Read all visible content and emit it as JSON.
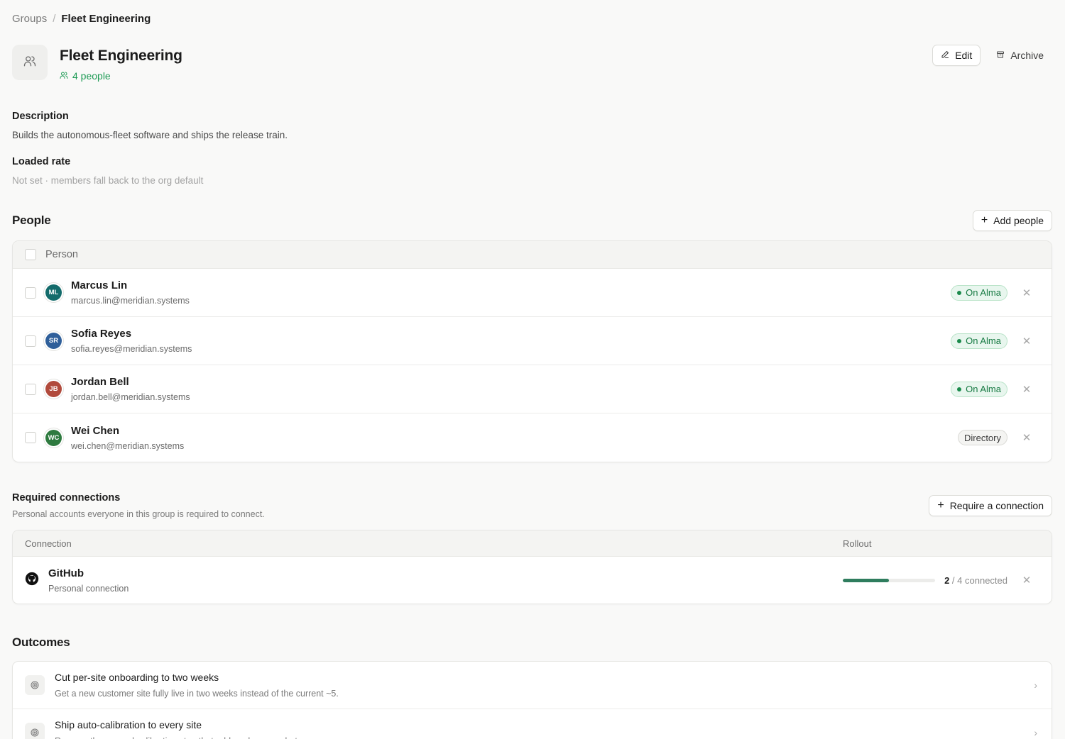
{
  "breadcrumb": {
    "parent": "Groups",
    "separator": "/",
    "current": "Fleet Engineering"
  },
  "group": {
    "title": "Fleet Engineering",
    "people_count": "4 people"
  },
  "header_actions": {
    "edit_label": "Edit",
    "archive_label": "Archive"
  },
  "description": {
    "label": "Description",
    "value": "Builds the autonomous-fleet software and ships the release train."
  },
  "loaded_rate": {
    "label": "Loaded rate",
    "value": "Not set · members fall back to the org default"
  },
  "people": {
    "title": "People",
    "add_label": "Add people",
    "column_person": "Person",
    "rows": [
      {
        "initials": "ML",
        "name": "Marcus Lin",
        "email": "marcus.lin@meridian.systems",
        "status": "On Alma",
        "status_type": "alma",
        "avatar_color": "#136b6b"
      },
      {
        "initials": "SR",
        "name": "Sofia Reyes",
        "email": "sofia.reyes@meridian.systems",
        "status": "On Alma",
        "status_type": "alma",
        "avatar_color": "#2f5f9a"
      },
      {
        "initials": "JB",
        "name": "Jordan Bell",
        "email": "jordan.bell@meridian.systems",
        "status": "On Alma",
        "status_type": "alma",
        "avatar_color": "#b14a3c"
      },
      {
        "initials": "WC",
        "name": "Wei Chen",
        "email": "wei.chen@meridian.systems",
        "status": "Directory",
        "status_type": "directory",
        "avatar_color": "#2e7a3f"
      }
    ]
  },
  "connections": {
    "title": "Required connections",
    "subtitle": "Personal accounts everyone in this group is required to connect.",
    "add_label": "Require a connection",
    "column_connection": "Connection",
    "column_rollout": "Rollout",
    "rows": [
      {
        "name": "GitHub",
        "kind": "Personal connection",
        "connected": "2",
        "separator": " / ",
        "total_label": "4 connected",
        "fraction": 0.5,
        "icon": "github-icon"
      }
    ]
  },
  "outcomes": {
    "title": "Outcomes",
    "rows": [
      {
        "title": "Cut per-site onboarding to two weeks",
        "desc": "Get a new customer site fully live in two weeks instead of the current ~5."
      },
      {
        "title": "Ship auto-calibration to every site",
        "desc": "Remove the manual calibration step that adds a day per robot."
      }
    ]
  },
  "colors": {
    "accent_green": "#1e9b55",
    "progress": "#2f7d5e",
    "background": "#f9f9f8"
  },
  "icons": [
    "users-icon",
    "pencil-icon",
    "archive-icon",
    "plus-icon",
    "close-icon",
    "github-icon",
    "target-icon",
    "chevron-right-icon"
  ]
}
